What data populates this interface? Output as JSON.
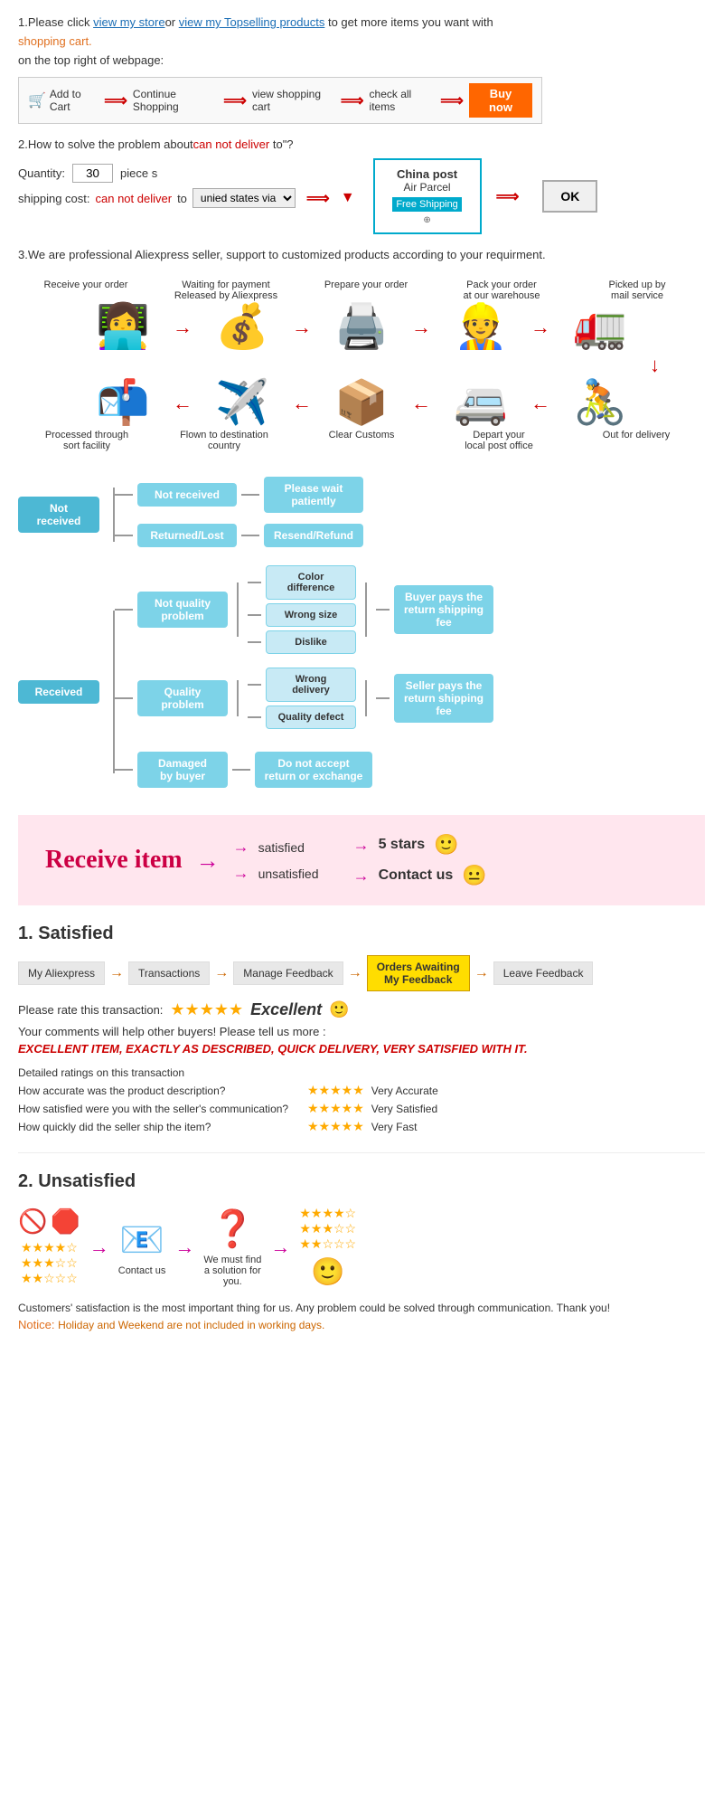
{
  "section1": {
    "text1": "1.Please click ",
    "link1": "view my store",
    "text2": "or ",
    "link2": "view my Topselling products",
    "text3": " to get more items you want with",
    "text4": "shopping cart.",
    "text5": "on the top right of webpage:",
    "steps": [
      {
        "label": "Add to Cart",
        "icon": "🛒"
      },
      {
        "label": "Continue Shopping"
      },
      {
        "label": "view shopping cart"
      },
      {
        "label": "check all items"
      },
      {
        "label": "Buy now",
        "highlight": true
      }
    ]
  },
  "section2": {
    "title": "2.How to solve the problem about",
    "can_not_deliver": "can not deliver",
    "title_end": " to\"?",
    "quantity_label": "Quantity:",
    "quantity_value": "30",
    "piece_label": "piece s",
    "shipping_label": "shipping cost:",
    "can_not": "can not deliver",
    "to_label": " to ",
    "via_label": "unied states via",
    "china_post_title": "China post",
    "air_parcel": "Air Parcel",
    "free_shipping": "Free Shipping",
    "ok_label": "OK"
  },
  "section3": {
    "text": "3.We are professional Aliexpress seller, support to customized products according to your requirment."
  },
  "process": {
    "top_labels": [
      "Receive your order",
      "Waiting for payment\nReleased by Aliexpress",
      "Prepare your order",
      "Pack your order\nat our warehouse",
      "Picked up by\nmail service"
    ],
    "bottom_labels": [
      "Out for delivery",
      "Depart your\nlocal post office",
      "Clear Customs",
      "Flown to destination\ncountry",
      "Processed through\nsort facility"
    ],
    "top_icons": [
      "👩‍💻",
      "💰",
      "🖨️",
      "👷",
      "🚛"
    ],
    "bottom_icons": [
      "🚴",
      "🚐",
      "📦",
      "✈️",
      "📬"
    ]
  },
  "not_received_tree": {
    "main_label": "Not received",
    "branch1": "Not received",
    "branch1_result": "Please wait\npatiently",
    "branch2": "Returned/Lost",
    "branch2_result": "Resend/Refund"
  },
  "received_tree": {
    "main_label": "Received",
    "branch1_label": "Not quality\nproblem",
    "branch1_sub": [
      "Color difference",
      "Wrong size",
      "Dislike"
    ],
    "branch1_result": "Buyer pays the\nreturn shipping fee",
    "branch2_label": "Quality\nproblem",
    "branch2_sub": [
      "Wrong delivery",
      "Quality defect"
    ],
    "branch2_result": "Seller pays the\nreturn shipping fee",
    "branch3_label": "Damaged\nby buyer",
    "branch3_result": "Do not accept\nreturn or exchange"
  },
  "pink_section": {
    "receive_item": "Receive item",
    "arrow": "→",
    "satisfied": "satisfied",
    "unsatisfied": "unsatisfied",
    "five_stars": "5 stars",
    "contact_us": "Contact us",
    "emoji_happy": "🙂",
    "emoji_neutral": "😐"
  },
  "satisfied_section": {
    "title_num": "1.",
    "title": "Satisfied",
    "steps": [
      "My Aliexpress",
      "Transactions",
      "Manage Feedback",
      "Orders Awaiting\nMy Feedback",
      "Leave Feedback"
    ],
    "rate_label": "Please rate this transaction:",
    "stars": "★★★★★",
    "excellent_label": "Excellent",
    "emoji": "🙂",
    "comment1": "Your comments will help other buyers! Please tell us more :",
    "excellent_text": "EXCELLENT ITEM, EXACTLY AS DESCRIBED, QUICK DELIVERY, VERY SATISFIED WITH IT.",
    "detailed_header": "Detailed ratings on this transaction",
    "rating1_label": "How accurate was the product description?",
    "rating1_stars": "★★★★★",
    "rating1_result": "Very Accurate",
    "rating2_label": "How satisfied were you with the seller's communication?",
    "rating2_stars": "★★★★★",
    "rating2_result": "Very Satisfied",
    "rating3_label": "How quickly did the seller ship the item?",
    "rating3_stars": "★★★★★",
    "rating3_result": "Very Fast"
  },
  "unsatisfied_section": {
    "title_num": "2.",
    "title": "Unsatisfied",
    "stars_low1": "★★★★☆",
    "stars_low2": "★★★☆☆",
    "stars_low3": "★★☆☆☆",
    "contact_label": "Contact us",
    "solution_label": "We must find\na solution for\nyou.",
    "footer_text": "Customers' satisfaction is the most important thing for us. Any problem could be solved through communication. Thank you!",
    "notice_label": "Notice:",
    "notice_text": "Holiday and Weekend are not included in working days."
  }
}
